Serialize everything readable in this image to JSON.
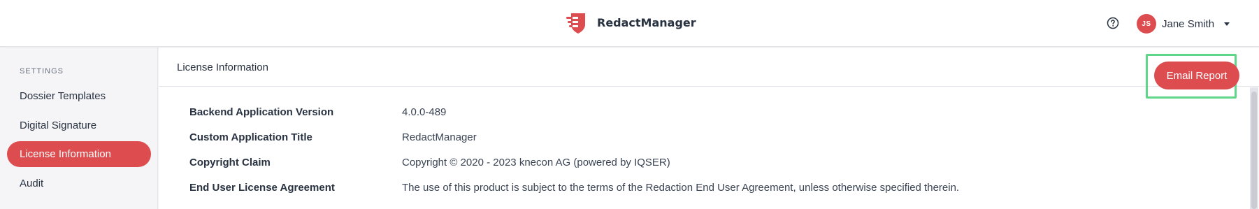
{
  "header": {
    "brand_name": "RedactManager",
    "help_icon": "help-circle-icon",
    "user": {
      "initials": "JS",
      "name": "Jane Smith"
    }
  },
  "sidebar": {
    "heading": "SETTINGS",
    "items": [
      {
        "label": "Dossier Templates",
        "active": false
      },
      {
        "label": "Digital Signature",
        "active": false
      },
      {
        "label": "License Information",
        "active": true
      },
      {
        "label": "Audit",
        "active": false
      }
    ]
  },
  "main": {
    "title": "License Information",
    "email_button": "Email Report",
    "rows": [
      {
        "label": "Backend Application Version",
        "value": "4.0.0-489"
      },
      {
        "label": "Custom Application Title",
        "value": "RedactManager"
      },
      {
        "label": "Copyright Claim",
        "value": "Copyright © 2020 - 2023 knecon AG (powered by IQSER)"
      },
      {
        "label": "End User License Agreement",
        "value": "The use of this product is subject to the terms of the Redaction End User Agreement, unless otherwise specified therein."
      }
    ]
  },
  "colors": {
    "accent": "#dd4d50",
    "highlight": "#5fd68a"
  }
}
